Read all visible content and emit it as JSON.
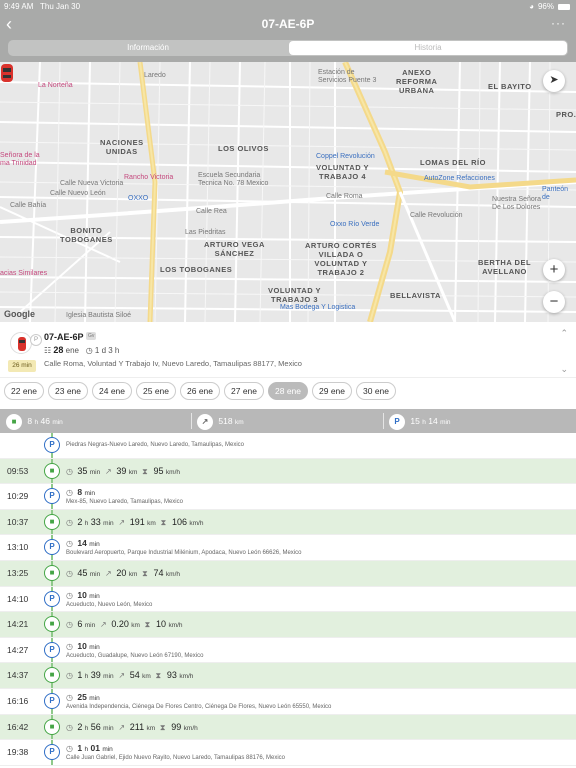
{
  "status": {
    "time": "9:49 AM",
    "date": "Thu Jan 30",
    "battery": "96%"
  },
  "header": {
    "title": "07-AE-6P",
    "tabs": [
      "Información",
      "Historia"
    ],
    "active_tab": "Historia"
  },
  "map": {
    "areas": [
      "ANEXO\nREFORMA\nURBANA",
      "EL BAYITO",
      "NACIONES\nUNIDAS",
      "LOS OLIVOS",
      "VOLUNTAD Y\nTRABAJO 4",
      "LOMAS DEL RÍO",
      "BONITO\nTOBOGANES",
      "ARTURO VEGA\nSÁNCHEZ",
      "ARTURO CORTÉS\nVILLADA O\nVOLUNTAD Y\nTRABAJO 2",
      "LOS TOBOGANES",
      "BERTHA DEL\nAVELLANO",
      "VOLUNTAD Y\nTRABAJO 3",
      "BELLAVISTA",
      "PRO..."
    ],
    "pois": [
      "La Norteña",
      "Estación de\nServicios Puente 3",
      "Señora de la\nma Trinidad",
      "Rancho Victoria",
      "Escuela Secundaria\nTecnica No. 78 Mexico",
      "Coppel Revolución",
      "AutoZone Refacciones",
      "OXXO",
      "Oxxo Río Verde",
      "Las Piedritas",
      "Nuestra Señora\nDe Los Dolores",
      "Panteón de",
      "acias Similares",
      "Mas Bodega Y Logistica",
      "Iglesia Bautista Siloé",
      "Calle Roma",
      "Calle Rea",
      "Laredo",
      "Calle Revolución",
      "Calle Bahía",
      "Calle Nueva Victoria",
      "Calle Nuevo León"
    ],
    "google": "Google"
  },
  "vehicle": {
    "plate": "07-AE-6P",
    "chip": "Gv",
    "date": "28",
    "date_unit": "ene",
    "stay": "1 d 3 h",
    "address": "Calle Roma, Voluntad Y Trabajo Iv, Nuevo Laredo, Tamaulipas 88177, Mexico",
    "duration_badge": "26 min"
  },
  "dates": [
    "22 ene",
    "23 ene",
    "24 ene",
    "25 ene",
    "26 ene",
    "27 ene",
    "28 ene",
    "29 ene",
    "30 ene"
  ],
  "selected_date": "28 ene",
  "summary": {
    "drive_h": "8",
    "drive_m": "46",
    "distance": "518",
    "distance_unit": "km",
    "park_h": "15",
    "park_m": "14",
    "h_unit": "h",
    "min_unit": "min"
  },
  "rows": [
    {
      "type": "park",
      "time": "",
      "duration": "",
      "address": "Piedras Negras-Nuevo Laredo, Nuevo Laredo, Tamaulipas, Mexico"
    },
    {
      "type": "drive",
      "time": "09:53",
      "duration": "35",
      "dur_unit": "min",
      "distance": "39",
      "speed": "95"
    },
    {
      "type": "park",
      "time": "10:29",
      "duration": "8",
      "dur_unit": "min",
      "address": "Mex-85, Nuevo Laredo, Tamaulipas, Mexico"
    },
    {
      "type": "drive",
      "time": "10:37",
      "duration": "2",
      "dur_unit": "h",
      "duration2": "33",
      "dur_unit2": "min",
      "distance": "191",
      "speed": "106"
    },
    {
      "type": "park",
      "time": "13:10",
      "duration": "14",
      "dur_unit": "min",
      "address": "Boulevard Aeropuerto, Parque Industrial Milénium, Apodaca, Nuevo León 66626, Mexico"
    },
    {
      "type": "drive",
      "time": "13:25",
      "duration": "45",
      "dur_unit": "min",
      "distance": "20",
      "speed": "74"
    },
    {
      "type": "park",
      "time": "14:10",
      "duration": "10",
      "dur_unit": "min",
      "address": "Acueducto, Nuevo León, Mexico"
    },
    {
      "type": "drive",
      "time": "14:21",
      "duration": "6",
      "dur_unit": "min",
      "distance": "0.20",
      "speed": "10"
    },
    {
      "type": "park",
      "time": "14:27",
      "duration": "10",
      "dur_unit": "min",
      "address": "Acueducto, Guadalupe, Nuevo León 67190, Mexico"
    },
    {
      "type": "drive",
      "time": "14:37",
      "duration": "1",
      "dur_unit": "h",
      "duration2": "39",
      "dur_unit2": "min",
      "distance": "54",
      "speed": "93"
    },
    {
      "type": "park",
      "time": "16:16",
      "duration": "25",
      "dur_unit": "min",
      "address": "Avenida Independencia, Ciénega De Flores Centro, Ciénega De Flores, Nuevo León 65550, Mexico"
    },
    {
      "type": "drive",
      "time": "16:42",
      "duration": "2",
      "dur_unit": "h",
      "duration2": "56",
      "dur_unit2": "min",
      "distance": "211",
      "speed": "99"
    },
    {
      "type": "park",
      "time": "19:38",
      "duration": "1",
      "dur_unit": "h",
      "duration2": "01",
      "dur_unit2": "min",
      "address": "Calle Juan Gabriel, Ejido Nuevo Rayito, Nuevo Laredo, Tamaulipas 88176, Mexico"
    }
  ],
  "units": {
    "km": "km",
    "kmh": "km/h"
  },
  "colors": {
    "header": "#a9aaa9",
    "drive_row": "#e2f0de",
    "park_icon": "#2f6ec6",
    "drive_icon": "#45a546",
    "summary_bar": "#b8b8b8"
  }
}
